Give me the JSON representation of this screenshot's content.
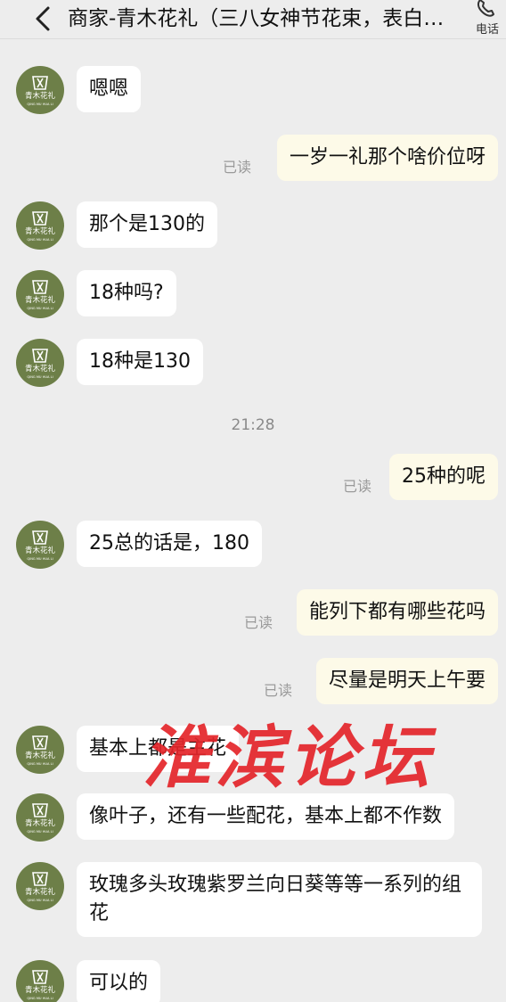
{
  "header": {
    "title": "商家-青木花礼（三八女神节花束，表白…",
    "phone_label": "电话"
  },
  "avatar_text": {
    "brand": "青木花礼",
    "pinyin": "QING MU HUA LI"
  },
  "messages": [
    {
      "side": "in",
      "text": "嗯嗯"
    },
    {
      "side": "out",
      "text": "一岁一礼那个啥价位呀",
      "status": "已读"
    },
    {
      "side": "in",
      "text": "那个是130的"
    },
    {
      "side": "in",
      "text": "18种吗?"
    },
    {
      "side": "in",
      "text": "18种是130"
    },
    {
      "side": "time",
      "text": "21:28"
    },
    {
      "side": "out",
      "text": "25种的呢",
      "status": "已读"
    },
    {
      "side": "in",
      "text": "25总的话是，180"
    },
    {
      "side": "out",
      "text": "能列下都有哪些花吗",
      "status": "已读"
    },
    {
      "side": "out",
      "text": "尽量是明天上午要",
      "status": "已读"
    },
    {
      "side": "in",
      "text": "基本上都是主花"
    },
    {
      "side": "in",
      "text": "像叶子，还有一些配花，基本上都不作数"
    },
    {
      "side": "in",
      "text": "玫瑰多头玫瑰紫罗兰向日葵等等一系列的组花"
    },
    {
      "side": "in",
      "text": "可以的"
    }
  ],
  "watermark": "淮滨论坛",
  "colors": {
    "background": "#ededed",
    "incoming_bubble": "#ffffff",
    "outgoing_bubble": "#fdfae8",
    "avatar": "#6d7f48",
    "watermark": "#e4252a"
  }
}
